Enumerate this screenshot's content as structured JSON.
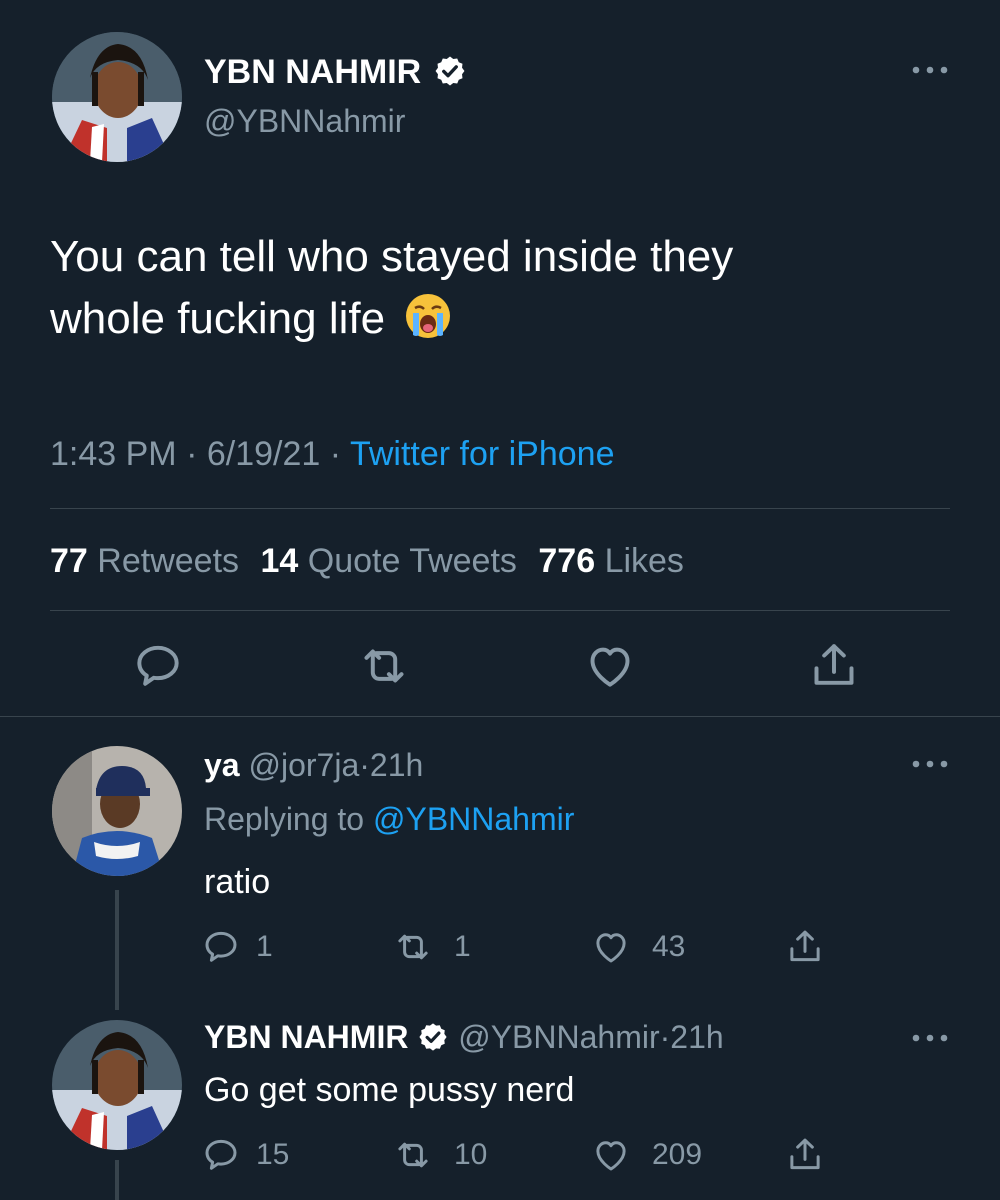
{
  "main_tweet": {
    "display_name": "YBN NAHMIR",
    "handle": "@YBNNahmir",
    "text_line1": "You can tell who stayed inside they",
    "text_line2": "whole fucking life",
    "emoji": "loudly-crying-face",
    "time": "1:43 PM",
    "date": "6/19/21",
    "separator": "·",
    "source": "Twitter for iPhone",
    "stats": {
      "retweets_count": "77",
      "retweets_label": "Retweets",
      "quotes_count": "14",
      "quotes_label": "Quote Tweets",
      "likes_count": "776",
      "likes_label": "Likes"
    }
  },
  "replies": [
    {
      "display_name": "ya",
      "handle": "@jor7ja",
      "separator": "·",
      "age": "21h",
      "replying_label": "Replying to",
      "replying_handle": "@YBNNahmir",
      "text": "ratio",
      "reply_count": "1",
      "retweet_count": "1",
      "like_count": "43"
    },
    {
      "display_name": "YBN NAHMIR",
      "handle": "@YBNNahmir",
      "separator": "·",
      "age": "21h",
      "text": "Go get some pussy nerd",
      "reply_count": "15",
      "retweet_count": "10",
      "like_count": "209"
    }
  ],
  "colors": {
    "background": "#15202b",
    "accent": "#1da1f2",
    "muted": "#8899a6",
    "divider": "#38444d"
  }
}
